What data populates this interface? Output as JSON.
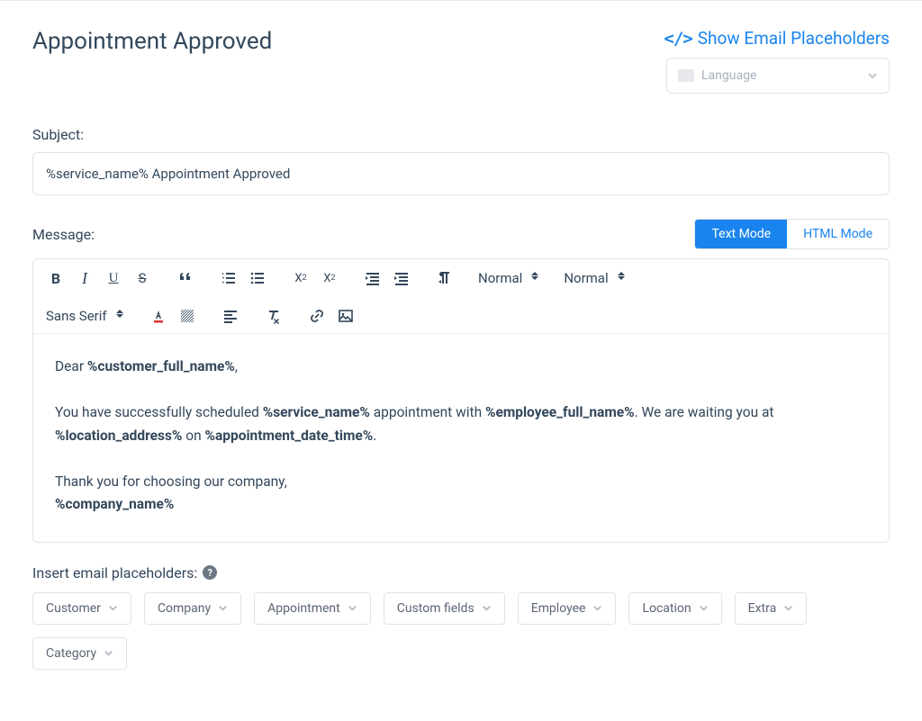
{
  "header": {
    "title": "Appointment Approved",
    "show_placeholders_label": "Show Email Placeholders",
    "language_placeholder": "Language"
  },
  "subject": {
    "label": "Subject:",
    "value": "%service_name% Appointment Approved"
  },
  "message": {
    "label": "Message:",
    "mode_text": "Text Mode",
    "mode_html": "HTML Mode"
  },
  "toolbar": {
    "header_select": "Normal",
    "size_select": "Normal",
    "font_select": "Sans Serif"
  },
  "editor": {
    "greeting_prefix": "Dear ",
    "greeting_placeholder": "%customer_full_name%",
    "greeting_suffix": ",",
    "body_p1_a": "You have successfully scheduled ",
    "body_p1_service": "%service_name%",
    "body_p1_b": " appointment with ",
    "body_p1_employee": "%employee_full_name%",
    "body_p1_c": ". We are waiting you at ",
    "body_p1_location": "%location_address%",
    "body_p1_d": " on ",
    "body_p1_datetime": "%appointment_date_time%",
    "body_p1_e": ".",
    "thanks": "Thank you for choosing our company,",
    "company": "%company_name%"
  },
  "insert": {
    "label": "Insert email placeholders:",
    "chips": [
      "Customer",
      "Company",
      "Appointment",
      "Custom fields",
      "Employee",
      "Location",
      "Extra",
      "Category"
    ]
  }
}
